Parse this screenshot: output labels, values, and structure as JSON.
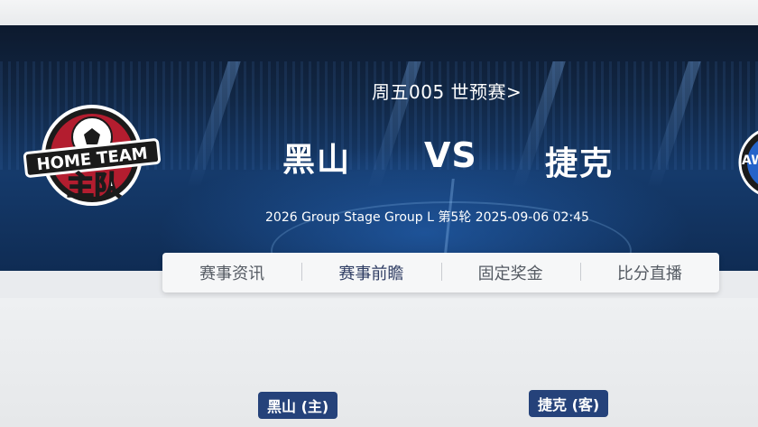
{
  "match": {
    "title": "周五005 世预赛>",
    "home_team": "黑山",
    "vs": "VS",
    "away_team": "捷克",
    "info": "2026 Group Stage Group L 第5轮 2025-09-06 02:45"
  },
  "logos": {
    "home_text_1": "HOME TEAM",
    "home_text_2": "主队",
    "away_text": "AW"
  },
  "tabs": [
    {
      "label": "赛事资讯",
      "active": false
    },
    {
      "label": "赛事前瞻",
      "active": true
    },
    {
      "label": "固定奖金",
      "active": false
    },
    {
      "label": "比分直播",
      "active": false
    }
  ],
  "badges": {
    "home": "黑山 (主)",
    "away": "捷克 (客)"
  },
  "colors": {
    "hero_dark": "#0d1a2e",
    "hero_blue": "#153a6b",
    "badge_blue": "#25427a",
    "logo_red": "#b31d2f"
  }
}
